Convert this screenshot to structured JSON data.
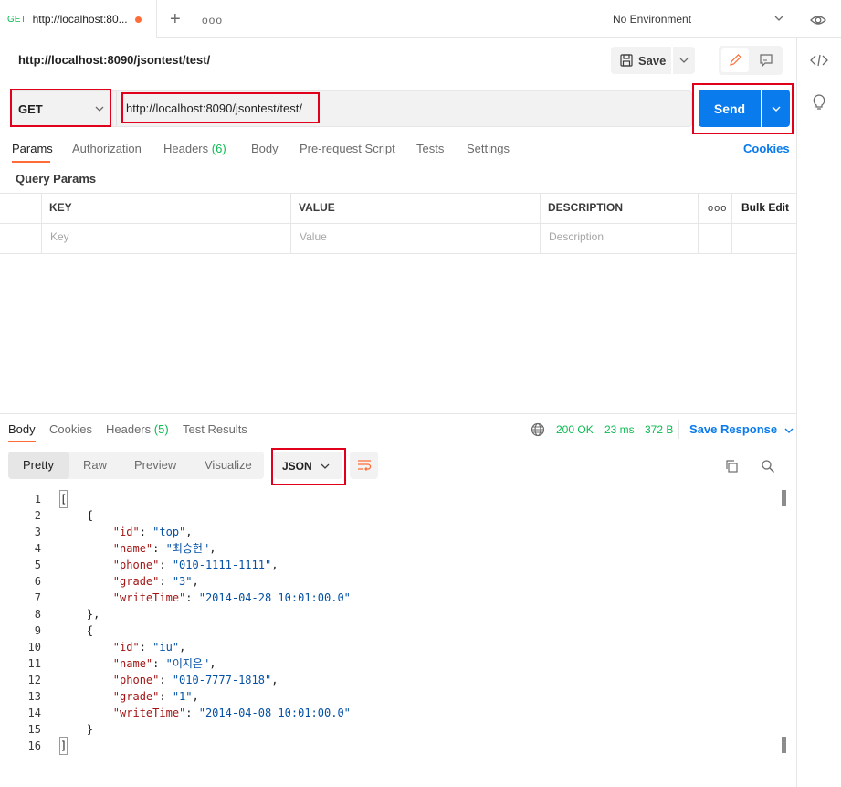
{
  "tab": {
    "method": "GET",
    "title": "http://localhost:80..."
  },
  "tabbar": {
    "more": "ooo"
  },
  "environment": {
    "label": "No Environment"
  },
  "request": {
    "title": "http://localhost:8090/jsontest/test/",
    "save_label": "Save",
    "method": "GET",
    "url": "http://localhost:8090/jsontest/test/",
    "send_label": "Send"
  },
  "request_tabs": {
    "params": "Params",
    "authorization": "Authorization",
    "headers": "Headers",
    "headers_count": "(6)",
    "body": "Body",
    "prerequest": "Pre-request Script",
    "tests": "Tests",
    "settings": "Settings",
    "cookies": "Cookies"
  },
  "query_params": {
    "label": "Query Params",
    "headers": {
      "key": "KEY",
      "value": "VALUE",
      "description": "DESCRIPTION",
      "more": "ooo",
      "bulk_edit": "Bulk Edit"
    },
    "placeholders": {
      "key": "Key",
      "value": "Value",
      "description": "Description"
    }
  },
  "response": {
    "tabs": {
      "body": "Body",
      "cookies": "Cookies",
      "headers": "Headers",
      "headers_count": "(5)",
      "test_results": "Test Results"
    },
    "status": "200 OK",
    "time": "23 ms",
    "size": "372 B",
    "save_response": "Save Response",
    "modes": {
      "pretty": "Pretty",
      "raw": "Raw",
      "preview": "Preview",
      "visualize": "Visualize"
    },
    "format": "JSON",
    "lines": [
      {
        "n": "1",
        "text": "["
      },
      {
        "n": "2",
        "text": "    {"
      },
      {
        "n": "3",
        "key": "\"id\"",
        "val": "\"top\"",
        "end": ","
      },
      {
        "n": "4",
        "key": "\"name\"",
        "val": "\"최승현\"",
        "end": ","
      },
      {
        "n": "5",
        "key": "\"phone\"",
        "val": "\"010-1111-1111\"",
        "end": ","
      },
      {
        "n": "6",
        "key": "\"grade\"",
        "val": "\"3\"",
        "end": ","
      },
      {
        "n": "7",
        "key": "\"writeTime\"",
        "val": "\"2014-04-28 10:01:00.0\"",
        "end": ""
      },
      {
        "n": "8",
        "text": "    },"
      },
      {
        "n": "9",
        "text": "    {"
      },
      {
        "n": "10",
        "key": "\"id\"",
        "val": "\"iu\"",
        "end": ","
      },
      {
        "n": "11",
        "key": "\"name\"",
        "val": "\"이지은\"",
        "end": ","
      },
      {
        "n": "12",
        "key": "\"phone\"",
        "val": "\"010-7777-1818\"",
        "end": ","
      },
      {
        "n": "13",
        "key": "\"grade\"",
        "val": "\"1\"",
        "end": ","
      },
      {
        "n": "14",
        "key": "\"writeTime\"",
        "val": "\"2014-04-08 10:01:00.0\"",
        "end": ""
      },
      {
        "n": "15",
        "text": "    }"
      },
      {
        "n": "16",
        "text": "]"
      }
    ]
  },
  "colors": {
    "accent": "#ff6c37",
    "primary": "#097bed",
    "success": "#0cbb52",
    "highlight": "#e0001b"
  }
}
